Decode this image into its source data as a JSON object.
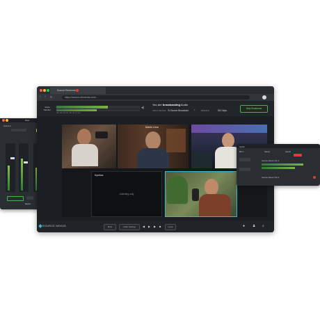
{
  "browser": {
    "tab_title": "Source Elements",
    "url": "https://source-elements.com/..."
  },
  "header": {
    "meter_label": "Voice Monitor",
    "meter_level": 0.62,
    "meter_level2": 0.48,
    "meter_scale": "-60  -50  -40  -30  -20  -10  -6  -3  0",
    "status_prefix": "You are",
    "status_bold": "broadcasting",
    "status_suffix": "Audio",
    "input_device_label": "INPUT DEVICE",
    "input_device_value": "To Source Broadcast",
    "bitrate_label": "BITRATE",
    "bitrate_value": "512 kbps",
    "stop_button": "Stop Broadcast"
  },
  "tiles": [
    {
      "name": ""
    },
    {
      "name": "Martin Lima"
    },
    {
      "name": ""
    },
    {
      "name": "Kymbra",
      "placeholder": "Listening only"
    },
    {
      "name": ""
    }
  ],
  "bottom": {
    "brand": "SOURCE NEXUS",
    "btn_mute": "Mute",
    "btn_listen": "Audio Settings",
    "btn_leave": "Leave"
  },
  "mixer": {
    "title": "Mixer",
    "source_label": "Source A",
    "out_label": "Output",
    "master_label": "Master",
    "levels": [
      0.55,
      0.7,
      0.5,
      0.62
    ]
  },
  "rpanel": {
    "title": "Inputs",
    "col1": "Mic 1",
    "col2": "Stereo",
    "col3": "Sends",
    "row1": "Source Nexus Out 1",
    "row2": "Source Nexus Out 2"
  },
  "colors": {
    "accent": "#7ed957",
    "panel": "#2a2d31",
    "window": "#1b1e22"
  }
}
